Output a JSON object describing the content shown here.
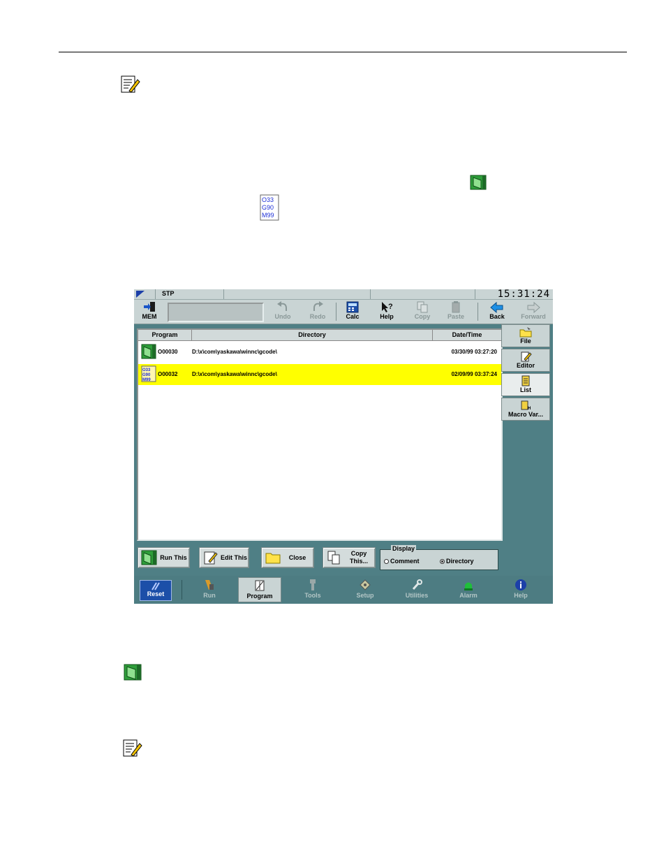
{
  "page": {
    "icons": [
      "note-pencil-icon",
      "run-program-icon",
      "gcode-file-icon"
    ]
  },
  "screen": {
    "status": {
      "mode": "STP",
      "clock": "15:31:24"
    },
    "toolbar": {
      "mem_label": "MEM",
      "command_value": "",
      "buttons": [
        {
          "label": "Undo",
          "icon": "undo-icon",
          "enabled": false
        },
        {
          "label": "Redo",
          "icon": "redo-icon",
          "enabled": false
        },
        {
          "label": "Calc",
          "icon": "calculator-icon",
          "enabled": true
        },
        {
          "label": "Help",
          "icon": "help-pointer-icon",
          "enabled": true
        },
        {
          "label": "Copy",
          "icon": "copy-icon",
          "enabled": false
        },
        {
          "label": "Paste",
          "icon": "paste-icon",
          "enabled": false
        },
        {
          "label": "Back",
          "icon": "back-arrow-icon",
          "enabled": true
        },
        {
          "label": "Forward",
          "icon": "forward-arrow-icon",
          "enabled": false
        }
      ]
    },
    "table": {
      "columns": [
        "Program",
        "Directory",
        "Date/Time"
      ],
      "rows": [
        {
          "program": "O00030",
          "directory": "D:\\x\\com\\yaskawa\\winnc\\gcode\\",
          "datetime": "03/30/99 03:27:20",
          "selected": false
        },
        {
          "program": "O00032",
          "directory": "D:\\x\\com\\yaskawa\\winnc\\gcode\\",
          "datetime": "02/09/99 03:37:24",
          "selected": true
        }
      ],
      "highlight_color": "#ffff00"
    },
    "actions": {
      "run_this": "Run This",
      "edit_this": "Edit This",
      "close": "Close",
      "copy_this": "Copy This..."
    },
    "display": {
      "legend": "Display",
      "options": [
        "Comment",
        "Directory"
      ],
      "selected": "Directory"
    },
    "side_tabs": [
      {
        "label": "File",
        "icon": "file-folder-icon",
        "active": false
      },
      {
        "label": "Editor",
        "icon": "editor-icon",
        "active": false
      },
      {
        "label": "List",
        "icon": "list-icon",
        "active": true
      },
      {
        "label": "Macro Var...",
        "icon": "macro-var-icon",
        "active": false
      }
    ],
    "nav": {
      "reset": "Reset",
      "items": [
        {
          "label": "Run",
          "active": false
        },
        {
          "label": "Program",
          "active": true
        },
        {
          "label": "Tools",
          "active": false
        },
        {
          "label": "Setup",
          "active": false
        },
        {
          "label": "Utilities",
          "active": false
        },
        {
          "label": "Alarm",
          "active": false
        },
        {
          "label": "Help",
          "active": false
        }
      ]
    }
  }
}
